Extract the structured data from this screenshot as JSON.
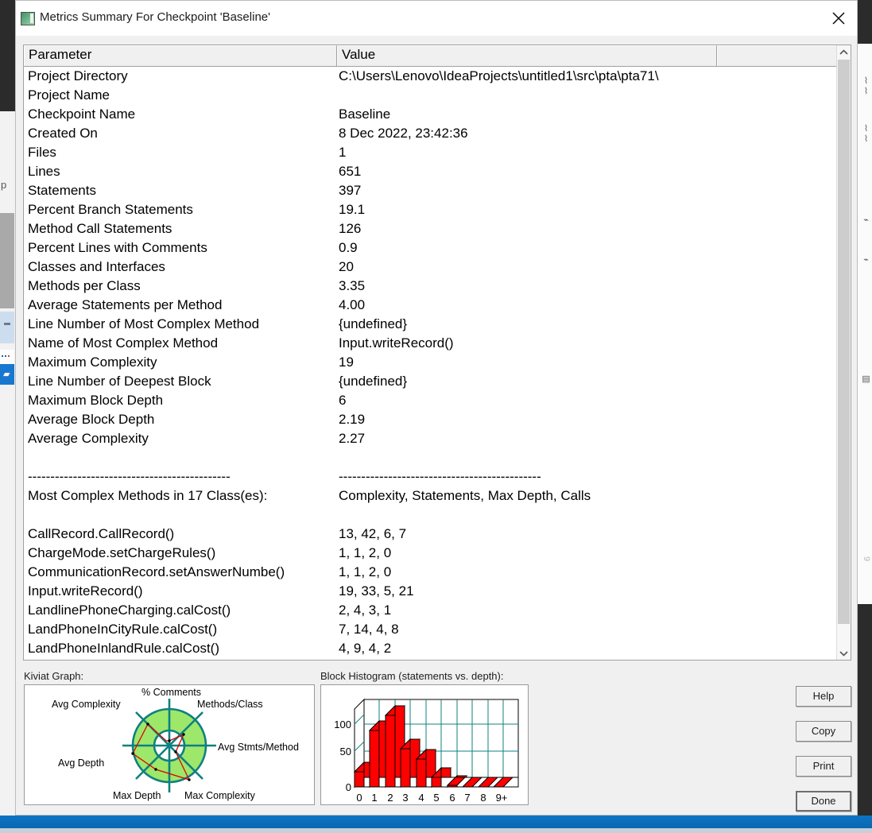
{
  "window": {
    "title": "Metrics Summary For Checkpoint 'Baseline'",
    "icon": "metrics-window-icon",
    "close_icon": "close-icon"
  },
  "table": {
    "headers": [
      "Parameter",
      "Value",
      ""
    ],
    "rows": [
      {
        "parameter": "Project Directory",
        "value": "C:\\Users\\Lenovo\\IdeaProjects\\untitled1\\src\\pta\\pta71\\"
      },
      {
        "parameter": "Project Name",
        "value": ""
      },
      {
        "parameter": "Checkpoint Name",
        "value": "Baseline"
      },
      {
        "parameter": "Created On",
        "value": "8 Dec 2022, 23:42:36"
      },
      {
        "parameter": "Files",
        "value": "1"
      },
      {
        "parameter": "Lines",
        "value": "651"
      },
      {
        "parameter": "Statements",
        "value": "397"
      },
      {
        "parameter": "Percent Branch Statements",
        "value": "19.1"
      },
      {
        "parameter": "Method Call Statements",
        "value": "126"
      },
      {
        "parameter": "Percent Lines with Comments",
        "value": "0.9"
      },
      {
        "parameter": "Classes and Interfaces",
        "value": "20"
      },
      {
        "parameter": "Methods per Class",
        "value": "3.35"
      },
      {
        "parameter": "Average Statements per Method",
        "value": "4.00"
      },
      {
        "parameter": "Line Number of Most Complex Method",
        "value": "{undefined}"
      },
      {
        "parameter": "Name of Most Complex Method",
        "value": "Input.writeRecord()"
      },
      {
        "parameter": "Maximum Complexity",
        "value": "19"
      },
      {
        "parameter": "Line Number of Deepest Block",
        "value": "{undefined}"
      },
      {
        "parameter": "Maximum Block Depth",
        "value": "6"
      },
      {
        "parameter": "Average Block Depth",
        "value": "2.19"
      },
      {
        "parameter": "Average Complexity",
        "value": "2.27"
      },
      {
        "parameter": "",
        "value": ""
      },
      {
        "parameter": "---------------------------------------------",
        "value": "---------------------------------------------"
      },
      {
        "parameter": "Most Complex Methods in 17 Class(es):",
        "value": "Complexity, Statements, Max Depth, Calls"
      },
      {
        "parameter": "",
        "value": ""
      },
      {
        "parameter": "CallRecord.CallRecord()",
        "value": "13, 42, 6, 7"
      },
      {
        "parameter": "ChargeMode.setChargeRules()",
        "value": "1, 1, 2, 0"
      },
      {
        "parameter": "CommunicationRecord.setAnswerNumbe()",
        "value": "1, 1, 2, 0"
      },
      {
        "parameter": "Input.writeRecord()",
        "value": "19, 33, 5, 21"
      },
      {
        "parameter": "LandlinePhoneCharging.calCost()",
        "value": "2, 4, 3, 1"
      },
      {
        "parameter": "LandPhoneInCityRule.calCost()",
        "value": "7, 14, 4, 8"
      },
      {
        "parameter": "LandPhoneInlandRule.calCost()",
        "value": "4, 9, 4, 2"
      }
    ]
  },
  "scrollbar": {
    "up_icon": "chevron-up-icon",
    "down_icon": "chevron-down-icon"
  },
  "panels": {
    "kiviat_label": "Kiviat Graph:",
    "histogram_label": "Block Histogram (statements vs. depth):"
  },
  "buttons": {
    "help": "Help",
    "copy": "Copy",
    "print": "Print",
    "done": "Done"
  },
  "colors": {
    "kiviat_ring": "#9de86a",
    "kiviat_spoke": "#0f8080",
    "kiviat_data": "#e00000",
    "histogram_bar": "#ff0000",
    "histogram_grid": "#0f8080",
    "title_bar": "#ffffff",
    "dialog_face": "#f0f0f0",
    "taskbar": "#0b74c4"
  },
  "chart_data": [
    {
      "type": "radar",
      "name": "kiviat-graph",
      "title": "Kiviat Graph:",
      "categories": [
        "% Comments",
        "Methods/Class",
        "Avg Stmts/Method",
        "Max Complexity",
        "Max Depth",
        "Avg Depth",
        "Avg Complexity"
      ],
      "axes": [
        "% Comments",
        "Methods/Class",
        "Avg Stmts/Method",
        "Max Complexity",
        "Max Depth",
        "Avg Depth",
        "Avg Complexity",
        "(unlabeled)"
      ],
      "values": [
        0.05,
        0.45,
        0.3,
        1.55,
        0.6,
        0.8,
        0.55,
        0.1
      ],
      "band_inner": 0.35,
      "band_outer": 1.0,
      "legend": "",
      "grid": true
    },
    {
      "type": "bar",
      "name": "block-histogram",
      "title": "Block Histogram (statements vs. depth):",
      "xlabel": "depth",
      "ylabel": "statements",
      "categories": [
        "0",
        "1",
        "2",
        "3",
        "4",
        "5",
        "6",
        "7",
        "8",
        "9+"
      ],
      "values": [
        27,
        101,
        128,
        68,
        49,
        16,
        3,
        0,
        0,
        0
      ],
      "ytick_labels": [
        "0",
        "50",
        "100"
      ],
      "yticks": [
        0,
        50,
        100
      ],
      "ylim": [
        0,
        140
      ],
      "grid": true,
      "legend": ""
    }
  ]
}
